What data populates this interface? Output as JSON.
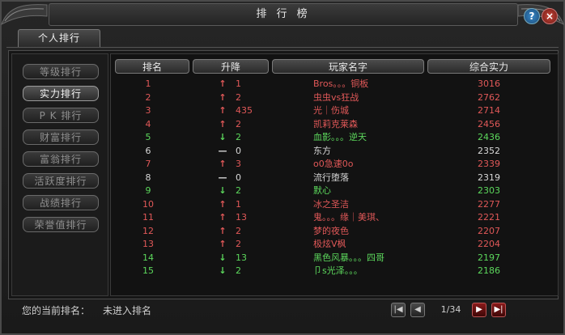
{
  "window": {
    "title": "排 行 榜"
  },
  "tabs": [
    {
      "label": "个人排行"
    }
  ],
  "sidebar": {
    "items": [
      {
        "label": "等级排行",
        "active": false
      },
      {
        "label": "实力排行",
        "active": true
      },
      {
        "label": "P K 排行",
        "active": false
      },
      {
        "label": "财富排行",
        "active": false
      },
      {
        "label": "富翁排行",
        "active": false
      },
      {
        "label": "活跃度排行",
        "active": false
      },
      {
        "label": "战绩排行",
        "active": false
      },
      {
        "label": "荣誉值排行",
        "active": false
      }
    ]
  },
  "table": {
    "headers": {
      "rank": "排名",
      "change": "升降",
      "player": "玩家名字",
      "power": "综合实力"
    },
    "rows": [
      {
        "rank": "1",
        "arrow": "up",
        "delta": "1",
        "name": "Bros。。。铜板",
        "power": "3016",
        "color": "#e05858"
      },
      {
        "rank": "2",
        "arrow": "up",
        "delta": "2",
        "name": "虫虫vs狂战",
        "power": "2762",
        "color": "#e05858"
      },
      {
        "rank": "3",
        "arrow": "up",
        "delta": "435",
        "name": "光｜伤城",
        "power": "2714",
        "color": "#e05858"
      },
      {
        "rank": "4",
        "arrow": "up",
        "delta": "2",
        "name": "凯莉克莱森",
        "power": "2456",
        "color": "#e05858"
      },
      {
        "rank": "5",
        "arrow": "down",
        "delta": "2",
        "name": "血影。。。逆天",
        "power": "2436",
        "color": "#5cd85c"
      },
      {
        "rank": "6",
        "arrow": "same",
        "delta": "0",
        "name": "东方",
        "power": "2352",
        "color": "#d8d8d8"
      },
      {
        "rank": "7",
        "arrow": "up",
        "delta": "3",
        "name": "o0急速0o",
        "power": "2339",
        "color": "#e05858"
      },
      {
        "rank": "8",
        "arrow": "same",
        "delta": "0",
        "name": "流行堕落",
        "power": "2319",
        "color": "#d8d8d8"
      },
      {
        "rank": "9",
        "arrow": "down",
        "delta": "2",
        "name": "默心",
        "power": "2303",
        "color": "#5cd85c"
      },
      {
        "rank": "10",
        "arrow": "up",
        "delta": "1",
        "name": "冰之圣洁",
        "power": "2277",
        "color": "#e05858"
      },
      {
        "rank": "11",
        "arrow": "up",
        "delta": "13",
        "name": "鬼。。。缘｜美琪、",
        "power": "2221",
        "color": "#e05858"
      },
      {
        "rank": "12",
        "arrow": "up",
        "delta": "2",
        "name": "梦的夜色",
        "power": "2207",
        "color": "#e05858"
      },
      {
        "rank": "13",
        "arrow": "up",
        "delta": "2",
        "name": "极炫V枫",
        "power": "2204",
        "color": "#e05858"
      },
      {
        "rank": "14",
        "arrow": "down",
        "delta": "13",
        "name": "黑色风暴。。。四哥",
        "power": "2197",
        "color": "#5cd85c"
      },
      {
        "rank": "15",
        "arrow": "down",
        "delta": "2",
        "name": "卩s光泽。。。",
        "power": "2186",
        "color": "#5cd85c"
      }
    ]
  },
  "footer": {
    "current_rank_label": "您的当前排名：",
    "current_rank_value": "未进入排名",
    "page_indicator": "1/34"
  },
  "colors": {
    "up": "#e05858",
    "down": "#5cd85c",
    "same": "#d8d8d8"
  }
}
